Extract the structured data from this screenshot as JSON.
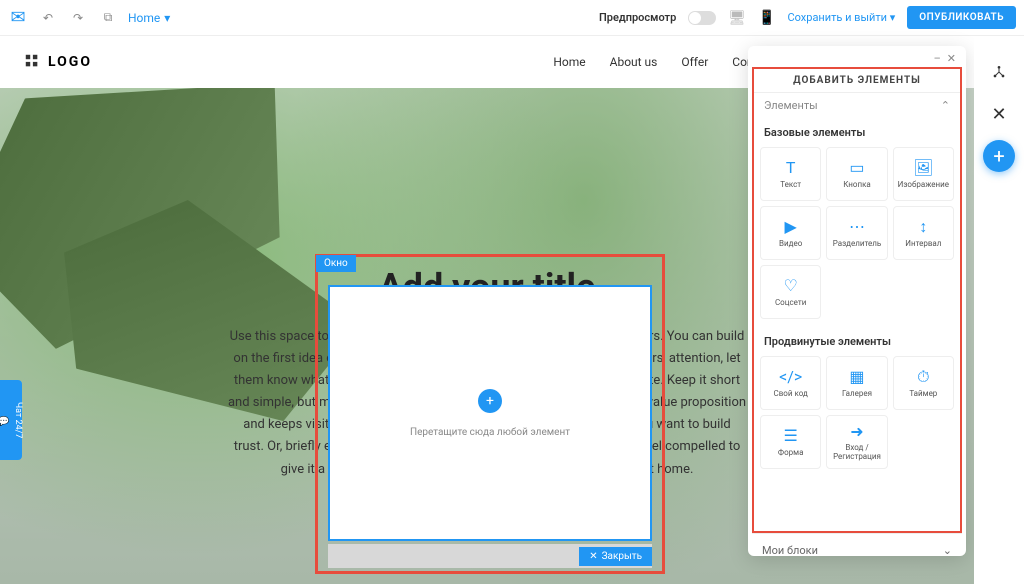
{
  "topbar": {
    "home": "Home",
    "preview": "Предпросмотр",
    "save_exit": "Сохранить и выйти",
    "publish": "ОПУБЛИКОВАТЬ"
  },
  "site": {
    "logo": "LOGO",
    "nav": [
      "Home",
      "About us",
      "Offer",
      "Contact us"
    ],
    "hero_title": "Add your title",
    "hero_text": "Use this space to elaborate on your headline and connect with your visitors. You can build on the first idea or add your second point. Now that you've got your visitors' attention, let them know what they can expect, and encourage them to explore your site. Keep it short and simple, but make sure your information that makes the most of your value proposition and keeps visitors hooked. Keep it short, so people don't get bored. You want to build trust. Or, briefly explain how your product or service works so that they feel compelled to give it a go. Customize the way your words look to drive the point home."
  },
  "popup": {
    "tag": "Окно",
    "hint": "Перетащите сюда любой элемент",
    "close": "Закрыть"
  },
  "panel": {
    "title": "ДОБАВИТЬ ЭЛЕМЕНТЫ",
    "elements": "Элементы",
    "basic": "Базовые элементы",
    "advanced": "Продвинутые элементы",
    "my_blocks": "Мои блоки",
    "tiles": {
      "text": "Текст",
      "button": "Кнопка",
      "image": "Изображение",
      "video": "Видео",
      "divider": "Разделитель",
      "spacer": "Интервал",
      "social": "Соцсети",
      "code": "Свой код",
      "gallery": "Галерея",
      "timer": "Таймер",
      "form": "Форма",
      "login": "Вход / Регистрация"
    }
  },
  "chat": "Чат 24/7"
}
